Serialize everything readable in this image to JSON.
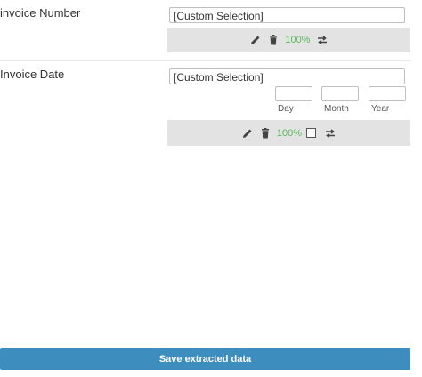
{
  "fields": {
    "invoice_number": {
      "label": "invoice Number",
      "selection_value": "[Custom Selection]",
      "confidence": "100%"
    },
    "invoice_date": {
      "label": "Invoice Date",
      "selection_value": "[Custom Selection]",
      "day_label": "Day",
      "month_label": "Month",
      "year_label": "Year",
      "confidence": "100%"
    }
  },
  "save_button": {
    "label": "Save extracted data"
  },
  "colors": {
    "confidence_green": "#5cb85c",
    "toolbar_bg": "#e3e3e3",
    "button_blue": "#3e8dbf"
  },
  "icons": [
    "pencil-icon",
    "trash-icon",
    "swap-arrows-icon",
    "checkbox"
  ]
}
